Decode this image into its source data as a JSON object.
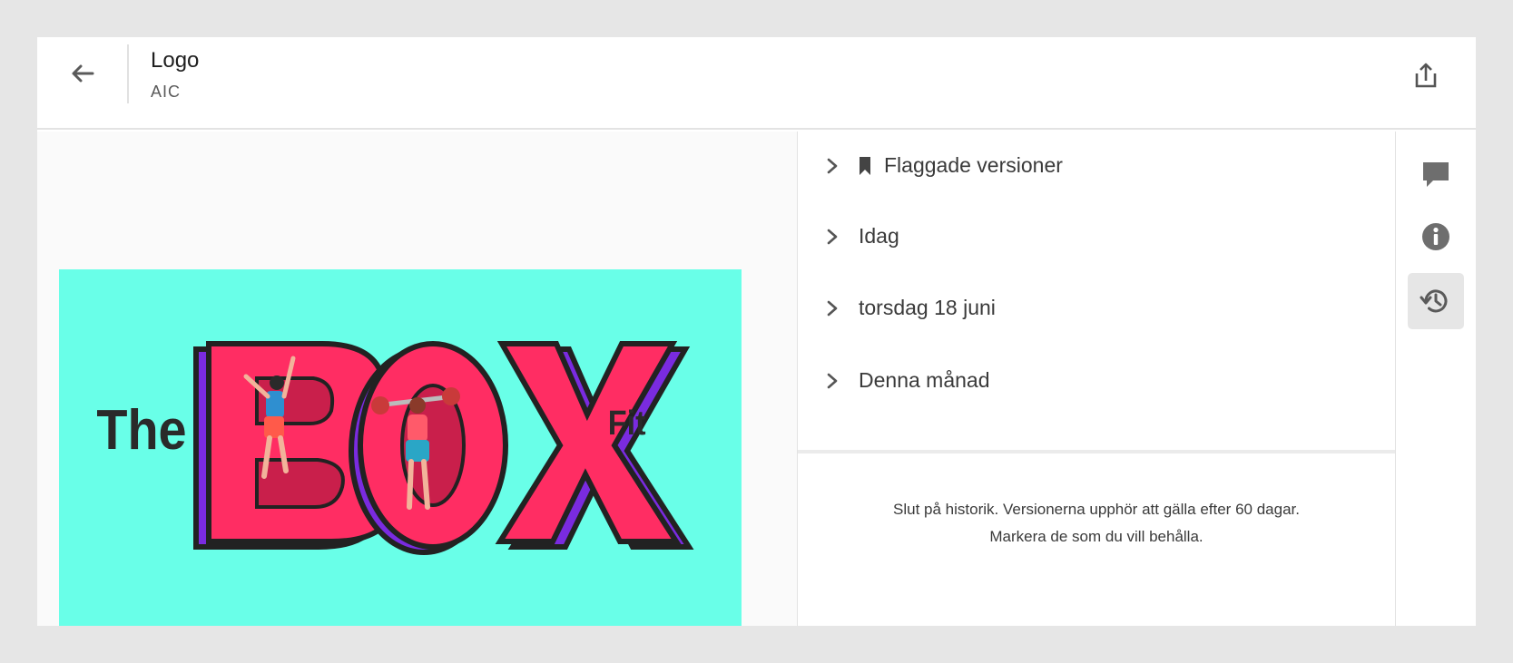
{
  "header": {
    "title": "Logo",
    "subtitle": "AIC",
    "back_icon": "arrow-left-icon",
    "share_icon": "share-upload-icon"
  },
  "artwork": {
    "text_left": "The",
    "text_main": "BOX",
    "text_right": "Fit",
    "background_color": "#69ffe8"
  },
  "versions": {
    "groups": [
      {
        "label": "Flaggade versioner",
        "icon": "bookmark-icon"
      },
      {
        "label": "Idag"
      },
      {
        "label": "torsdag 18 juni"
      },
      {
        "label": "Denna månad"
      }
    ],
    "end_note_line1": "Slut på historik. Versionerna upphör att gälla efter 60 dagar.",
    "end_note_line2": "Markera de som du vill behålla."
  },
  "rail": {
    "items": [
      {
        "name": "comments",
        "icon": "comment-icon",
        "active": false
      },
      {
        "name": "info",
        "icon": "info-icon",
        "active": false
      },
      {
        "name": "version-history",
        "icon": "history-icon",
        "active": true
      }
    ]
  },
  "colors": {
    "accent_pink": "#ff2d63",
    "accent_purple": "#7a2be0",
    "accent_yellow": "#ffd84a",
    "icon_gray": "#6e6e6e"
  }
}
